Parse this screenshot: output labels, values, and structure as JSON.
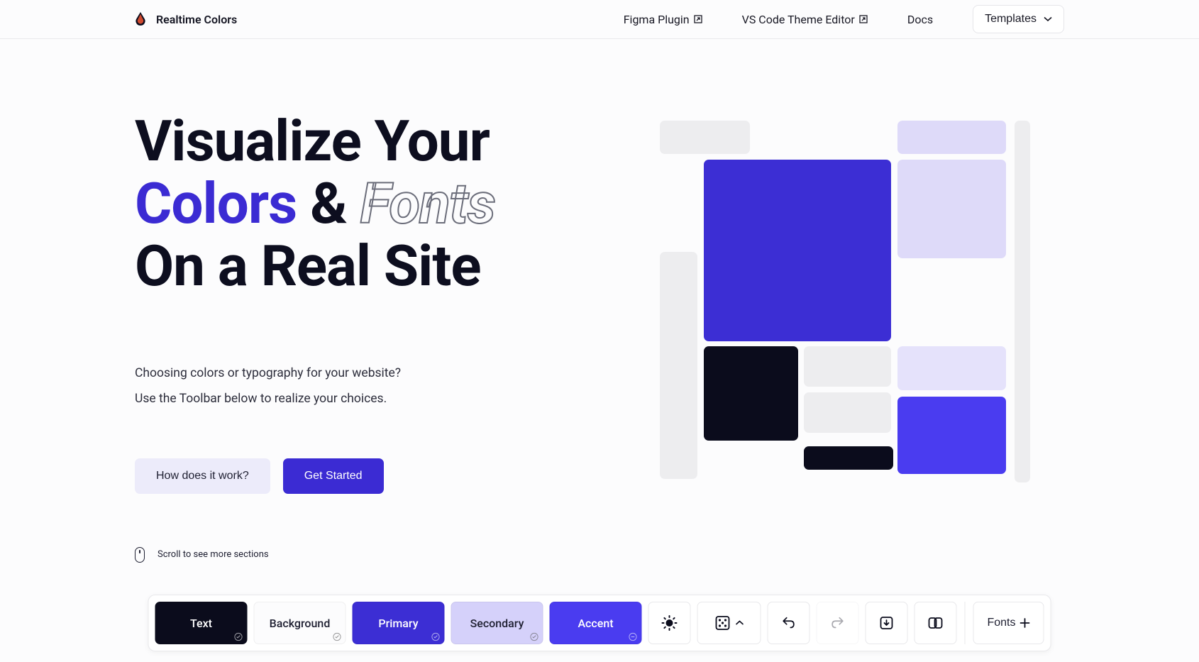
{
  "header": {
    "brand": "Realtime Colors",
    "nav": {
      "figma": "Figma Plugin",
      "vscode": "VS Code Theme Editor",
      "docs": "Docs",
      "templates": "Templates"
    }
  },
  "hero": {
    "title_line1": "Visualize Your",
    "colors_word": "Colors",
    "amp": " & ",
    "fonts_word": "Fonts",
    "title_line3": "On a Real Site",
    "desc_line1": "Choosing colors or typography for your website?",
    "desc_line2": "Use the Toolbar below to realize your choices.",
    "btn_how": "How does it work?",
    "btn_start": "Get Started",
    "scroll_hint": "Scroll to see more sections"
  },
  "toolbar": {
    "text_label": "Text",
    "bg_label": "Background",
    "primary_label": "Primary",
    "secondary_label": "Secondary",
    "accent_label": "Accent",
    "fonts_label": "Fonts"
  },
  "colors": {
    "text": "#0b0c1c",
    "background": "#fcfcfd",
    "primary": "#3c2ed4",
    "secondary": "#d5d1fa",
    "accent": "#4a3cf0",
    "light_grey": "#ededef",
    "light_lavender": "#dedaf9"
  }
}
